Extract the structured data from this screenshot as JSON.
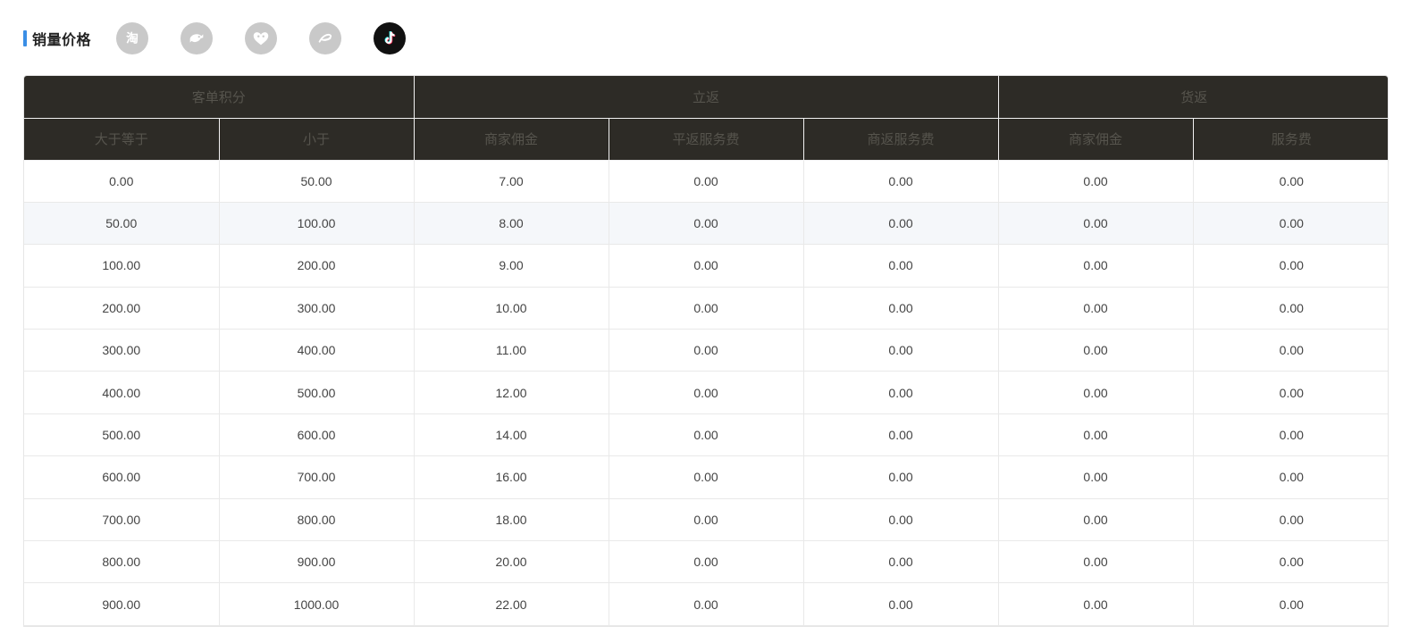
{
  "section_title": "销量价格",
  "platforms": [
    {
      "name": "taobao-icon",
      "active": false
    },
    {
      "name": "tmall-icon",
      "active": false
    },
    {
      "name": "pinduoduo-icon",
      "active": false
    },
    {
      "name": "alibaba-icon",
      "active": false
    },
    {
      "name": "douyin-icon",
      "active": true
    }
  ],
  "colors": {
    "accent": "#3a8ee6",
    "header_bg": "#2d2b26",
    "icon_inactive": "#c9c9c9",
    "icon_active": "#111111"
  },
  "table": {
    "group_headers": {
      "g1": "客单积分",
      "g2": "立返",
      "g3": "货返"
    },
    "columns": {
      "c1": "大于等于",
      "c2": "小于",
      "c3": "商家佣金",
      "c4": "平返服务费",
      "c5": "商返服务费",
      "c6": "商家佣金",
      "c7": "服务费"
    },
    "rows": [
      [
        "0.00",
        "50.00",
        "7.00",
        "0.00",
        "0.00",
        "0.00",
        "0.00"
      ],
      [
        "50.00",
        "100.00",
        "8.00",
        "0.00",
        "0.00",
        "0.00",
        "0.00"
      ],
      [
        "100.00",
        "200.00",
        "9.00",
        "0.00",
        "0.00",
        "0.00",
        "0.00"
      ],
      [
        "200.00",
        "300.00",
        "10.00",
        "0.00",
        "0.00",
        "0.00",
        "0.00"
      ],
      [
        "300.00",
        "400.00",
        "11.00",
        "0.00",
        "0.00",
        "0.00",
        "0.00"
      ],
      [
        "400.00",
        "500.00",
        "12.00",
        "0.00",
        "0.00",
        "0.00",
        "0.00"
      ],
      [
        "500.00",
        "600.00",
        "14.00",
        "0.00",
        "0.00",
        "0.00",
        "0.00"
      ],
      [
        "600.00",
        "700.00",
        "16.00",
        "0.00",
        "0.00",
        "0.00",
        "0.00"
      ],
      [
        "700.00",
        "800.00",
        "18.00",
        "0.00",
        "0.00",
        "0.00",
        "0.00"
      ],
      [
        "800.00",
        "900.00",
        "20.00",
        "0.00",
        "0.00",
        "0.00",
        "0.00"
      ],
      [
        "900.00",
        "1000.00",
        "22.00",
        "0.00",
        "0.00",
        "0.00",
        "0.00"
      ]
    ]
  }
}
